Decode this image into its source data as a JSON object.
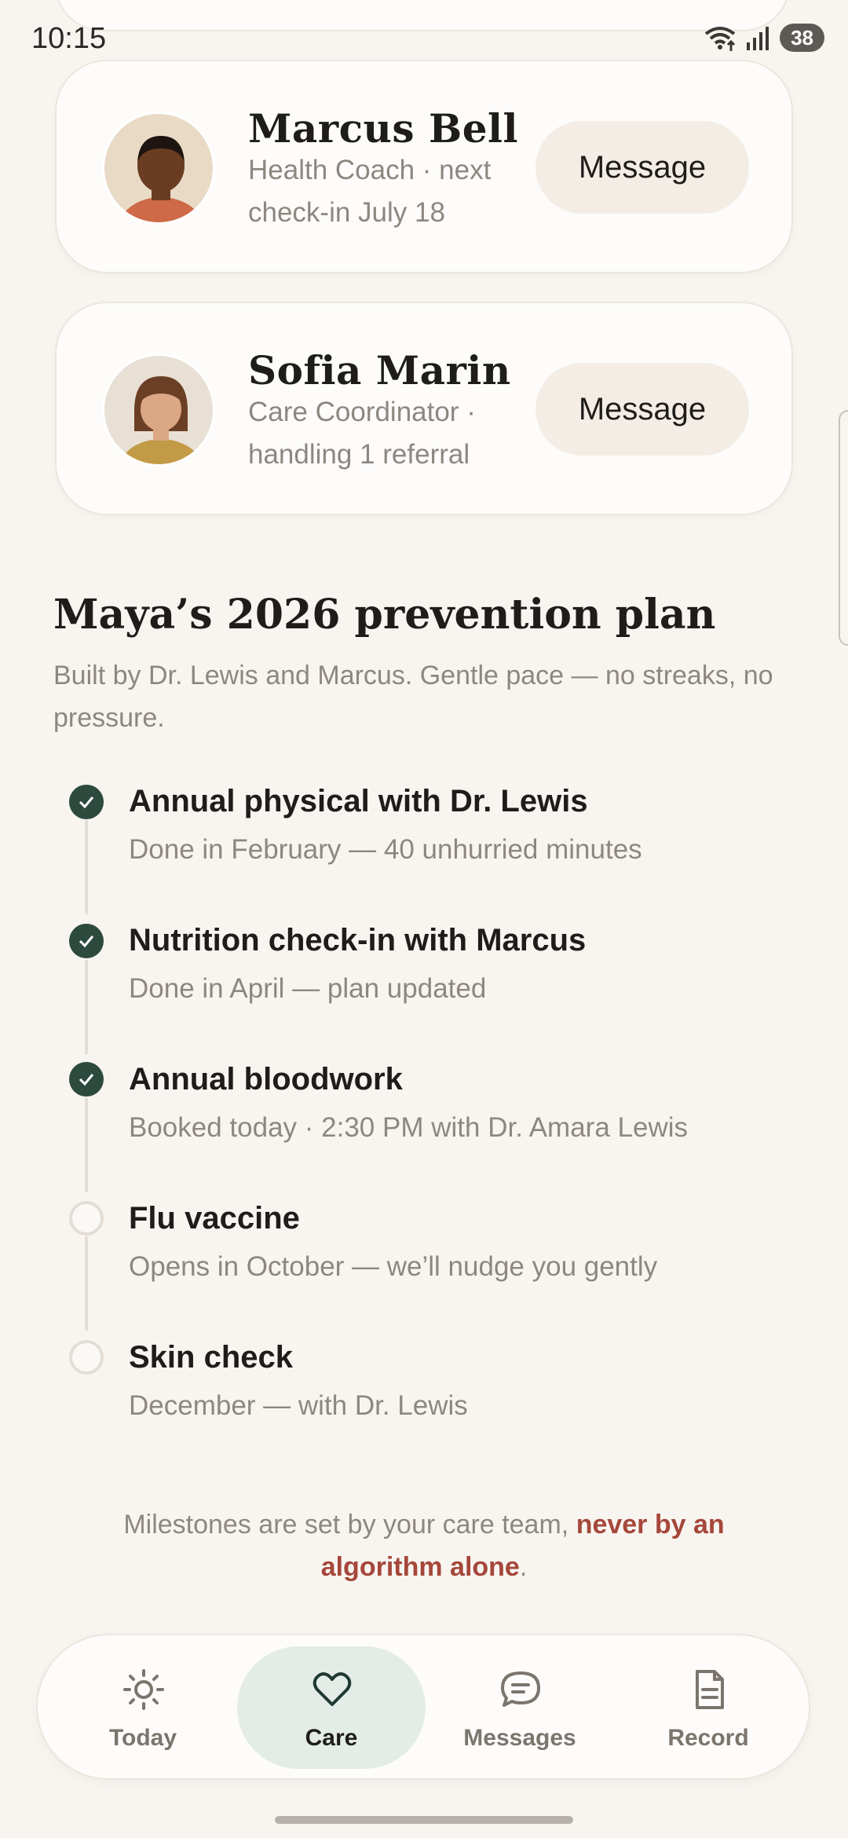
{
  "status": {
    "time": "10:15",
    "battery": "38"
  },
  "care_team": [
    {
      "name": "Marcus Bell",
      "role_line1": "Health Coach · next",
      "role_line2": "check-in July 18",
      "action": "Message"
    },
    {
      "name": "Sofia Marin",
      "role_line1": "Care Coordinator ·",
      "role_line2": "handling 1 referral",
      "action": "Message"
    }
  ],
  "plan": {
    "title": "Maya’s 2026 prevention plan",
    "subtitle": "Built by Dr. Lewis and Marcus. Gentle pace — no streaks, no pressure.",
    "milestones": [
      {
        "title": "Annual physical with Dr. Lewis",
        "detail": "Done in February — 40 unhurried minutes",
        "done": true
      },
      {
        "title": "Nutrition check-in with Marcus",
        "detail": "Done in April — plan updated",
        "done": true
      },
      {
        "title": "Annual bloodwork",
        "detail": "Booked today · 2:30 PM with Dr. Amara Lewis",
        "done": true
      },
      {
        "title": "Flu vaccine",
        "detail": "Opens in October — we’ll nudge you gently",
        "done": false
      },
      {
        "title": "Skin check",
        "detail": "December — with Dr. Lewis",
        "done": false
      }
    ]
  },
  "footnote": {
    "text": "Milestones are set by your care team, ",
    "accent": "never by an algorithm alone",
    "end": "."
  },
  "nav": {
    "items": [
      {
        "label": "Today",
        "icon": "sun-icon"
      },
      {
        "label": "Care",
        "icon": "heart-icon",
        "active": true
      },
      {
        "label": "Messages",
        "icon": "chat-icon"
      },
      {
        "label": "Record",
        "icon": "document-icon"
      }
    ]
  },
  "colors": {
    "accent_green": "#2d4a3e",
    "accent_red": "#a5473a",
    "active_nav_bg": "#e4ece7"
  }
}
